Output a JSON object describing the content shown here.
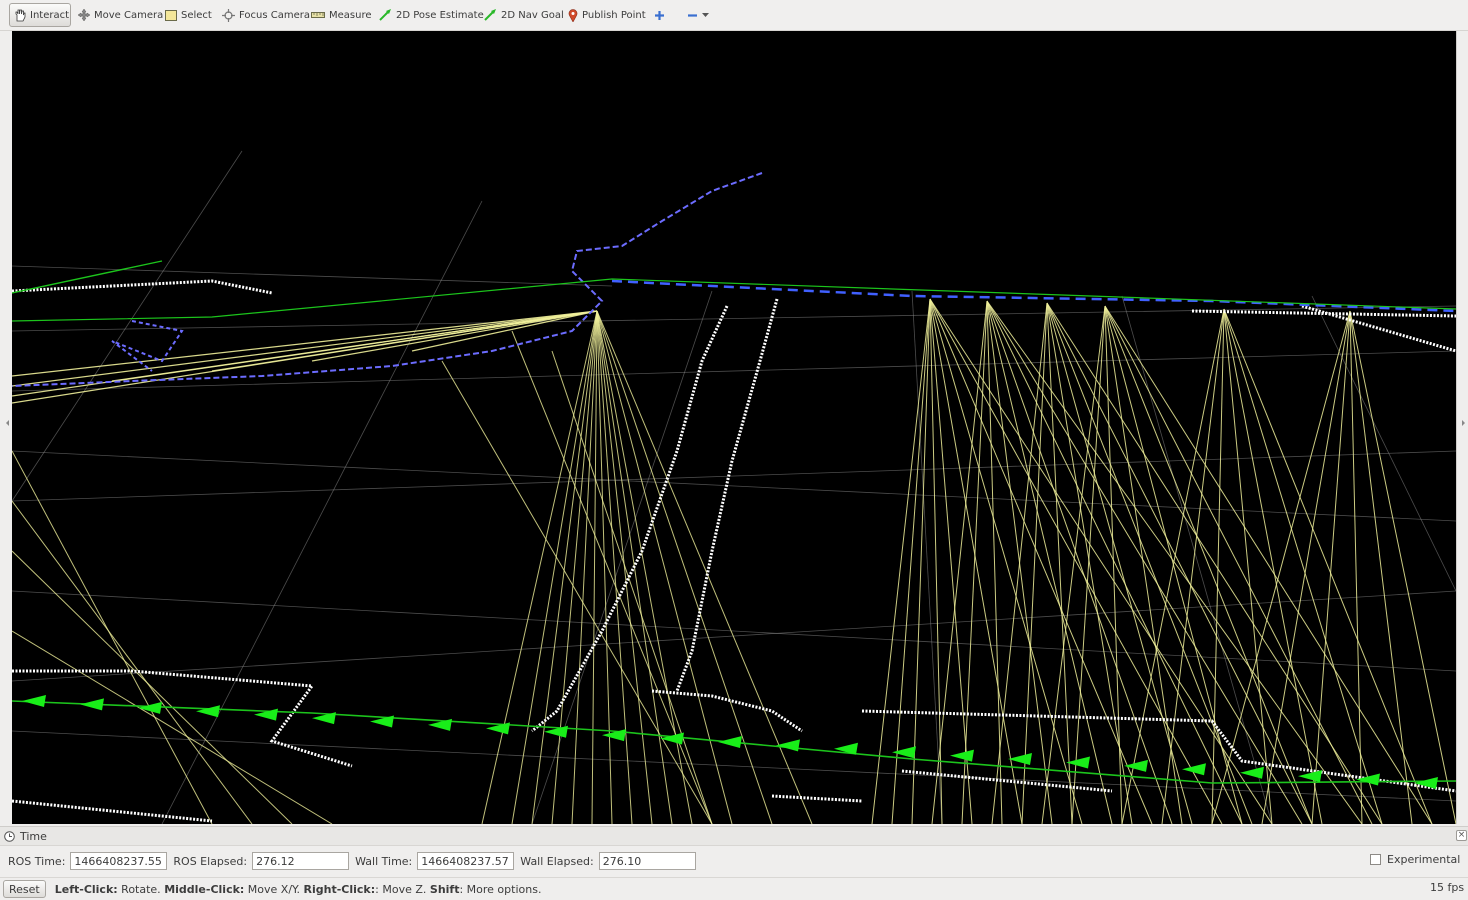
{
  "toolbar": {
    "tools": [
      {
        "label": "Interact",
        "icon": "hand-icon",
        "active": true
      },
      {
        "label": "Move Camera",
        "icon": "move-camera-icon"
      },
      {
        "label": "Select",
        "icon": "select-box-icon"
      },
      {
        "label": "Focus Camera",
        "icon": "focus-camera-icon"
      },
      {
        "label": "Measure",
        "icon": "ruler-icon"
      },
      {
        "label": "2D Pose Estimate",
        "icon": "green-arrow-icon"
      },
      {
        "label": "2D Nav Goal",
        "icon": "green-arrow-icon"
      },
      {
        "label": "Publish Point",
        "icon": "map-pin-icon"
      }
    ],
    "add_tool_icon": "plus-icon",
    "remove_tool_icon": "minus-icon"
  },
  "time_panel": {
    "title": "Time",
    "ros_time_label": "ROS Time:",
    "ros_time": "1466408237.55",
    "ros_elapsed_label": "ROS Elapsed:",
    "ros_elapsed": "276.12",
    "wall_time_label": "Wall Time:",
    "wall_time": "1466408237.57",
    "wall_elapsed_label": "Wall Elapsed:",
    "wall_elapsed": "276.10",
    "experimental_label": "Experimental",
    "experimental_checked": false
  },
  "status": {
    "reset_label": "Reset",
    "hint_left_click": "Left-Click:",
    "hint_rotate": " Rotate. ",
    "hint_middle_click": "Middle-Click:",
    "hint_move_xy": " Move X/Y. ",
    "hint_right_click": "Right-Click:",
    "hint_move_z": ": Move Z. ",
    "hint_shift": "Shift",
    "hint_more": ": More options.",
    "fps": "15 fps"
  },
  "colors": {
    "viewport_bg": "#000000",
    "grid": "#8a8a8a",
    "laser_rays": "#f0f09a",
    "point_cloud": "#ffffff",
    "path": "#1cc41c",
    "pose_arrows": "#19ee19",
    "trajectory": "#6c6cff"
  }
}
